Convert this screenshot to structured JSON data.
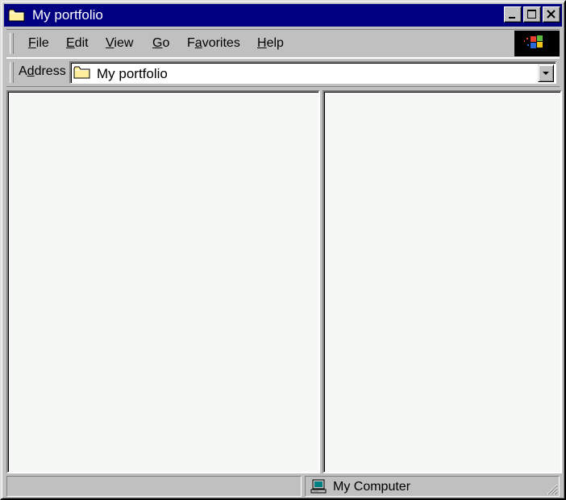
{
  "window": {
    "title": "My portfolio",
    "title_icon": "folder-icon",
    "controls": [
      "minimize-icon",
      "maximize-icon",
      "close-icon"
    ]
  },
  "menu": {
    "items": [
      {
        "label": "File",
        "mnemonic": "F",
        "rest": "ile"
      },
      {
        "label": "Edit",
        "mnemonic": "E",
        "rest": "dit"
      },
      {
        "label": "View",
        "mnemonic": "V",
        "rest": "iew"
      },
      {
        "label": "Go",
        "mnemonic": "G",
        "rest": "o"
      },
      {
        "label": "Favorites",
        "pre": "F",
        "mnemonic": "a",
        "rest": "vorites"
      },
      {
        "label": "Help",
        "mnemonic": "H",
        "rest": "elp"
      }
    ],
    "logo": "windows-logo-icon"
  },
  "address": {
    "label_pre": "A",
    "label_mnemonic": "d",
    "label_rest": "dress",
    "value": "My portfolio",
    "icon": "folder-icon"
  },
  "status": {
    "zone_text": "My Computer",
    "zone_icon": "computer-icon"
  },
  "colors": {
    "titlebar": "#000080",
    "chrome": "#c0c0c0",
    "pane_background": "#f5f8f5"
  }
}
